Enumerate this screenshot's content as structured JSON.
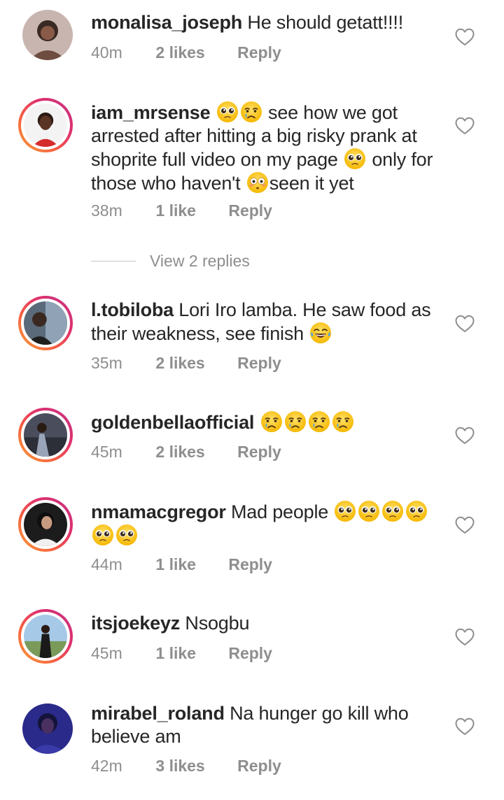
{
  "comments": [
    {
      "username": "monalisa_joseph",
      "text": "He should getatt!!!!",
      "time": "40m",
      "likes": "2 likes",
      "reply": "Reply"
    },
    {
      "username": "iam_mrsense",
      "text_1": "see how we got arrested after hitting a big risky prank at shoprite full video on my page",
      "text_2": "only for those who haven't",
      "text_3": "seen it yet",
      "time": "38m",
      "likes": "1 like",
      "reply": "Reply",
      "view_replies": "View 2 replies"
    },
    {
      "username": "l.tobiloba",
      "text": "Lori Iro lamba. He saw food as their weakness, see finish",
      "time": "35m",
      "likes": "2 likes",
      "reply": "Reply"
    },
    {
      "username": "goldenbellaofficial",
      "text": "",
      "time": "45m",
      "likes": "2 likes",
      "reply": "Reply"
    },
    {
      "username": "nmamacgregor",
      "text": "Mad people",
      "time": "44m",
      "likes": "1 like",
      "reply": "Reply"
    },
    {
      "username": "itsjoekeyz",
      "text": "Nsogbu",
      "time": "45m",
      "likes": "1 like",
      "reply": "Reply"
    },
    {
      "username": "mirabel_roland",
      "text": "Na hunger go kill who believe am",
      "time": "42m",
      "likes": "3 likes",
      "reply": "Reply"
    }
  ],
  "icons": {
    "heart": "heart-outline-icon",
    "pleading": "pleading-face-emoji",
    "crying": "crying-face-emoji",
    "flushed": "flushed-face-emoji",
    "laughing": "tears-of-joy-emoji"
  },
  "colors": {
    "text": "#262626",
    "meta": "#8e8e8e",
    "ring_start": "#f9a13a",
    "ring_end": "#c13584"
  }
}
